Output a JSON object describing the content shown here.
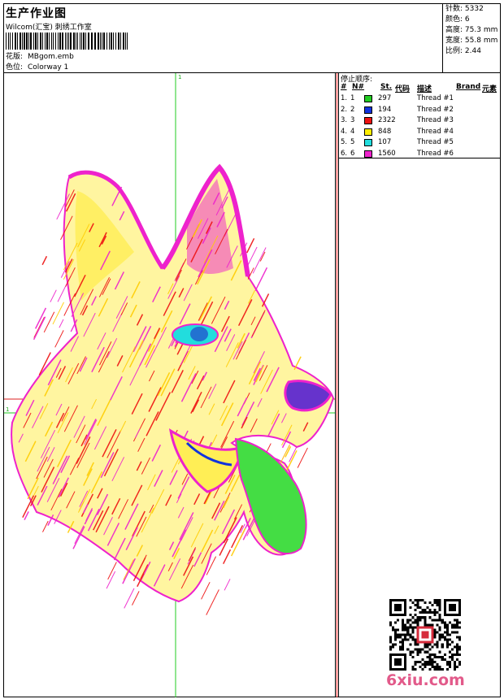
{
  "header": {
    "title": "生产作业图",
    "subtitle": "Wilcom(汇宝) 刺绣工作室",
    "design_label": "花版:",
    "design_value": "MBgom.emb",
    "colorway_label": "色位:",
    "colorway_value": "Colorway 1"
  },
  "stats": [
    {
      "label": "针数:",
      "value": "5332"
    },
    {
      "label": "颜色:",
      "value": "6"
    },
    {
      "label": "高度:",
      "value": "75.3 mm"
    },
    {
      "label": "宽度:",
      "value": "55.8 mm"
    },
    {
      "label": "比例:",
      "value": "2.44"
    }
  ],
  "canvas": {
    "marker_top": "1",
    "marker_left": "1",
    "guide_color": "#22cc22",
    "crosshair_color": "#dd2222"
  },
  "legend": {
    "title": "停止顺序:",
    "headers": {
      "num": "#",
      "nno": "N#",
      "st": "St.",
      "code": "代码",
      "desc": "描述",
      "brand": "Brand",
      "elem": "元素"
    },
    "rows": [
      {
        "num": "1.",
        "nno": "1",
        "color": "#22cc22",
        "st": "297",
        "desc": "Thread #1"
      },
      {
        "num": "2.",
        "nno": "2",
        "color": "#1133dd",
        "st": "194",
        "desc": "Thread #2"
      },
      {
        "num": "3.",
        "nno": "3",
        "color": "#ee1111",
        "st": "2322",
        "desc": "Thread #3"
      },
      {
        "num": "4.",
        "nno": "4",
        "color": "#ffee00",
        "st": "848",
        "desc": "Thread #4"
      },
      {
        "num": "5.",
        "nno": "5",
        "color": "#22dddd",
        "st": "107",
        "desc": "Thread #5"
      },
      {
        "num": "6.",
        "nno": "6",
        "color": "#ee22cc",
        "st": "1560",
        "desc": "Thread #6"
      }
    ]
  },
  "watermark": "6xiu.com"
}
